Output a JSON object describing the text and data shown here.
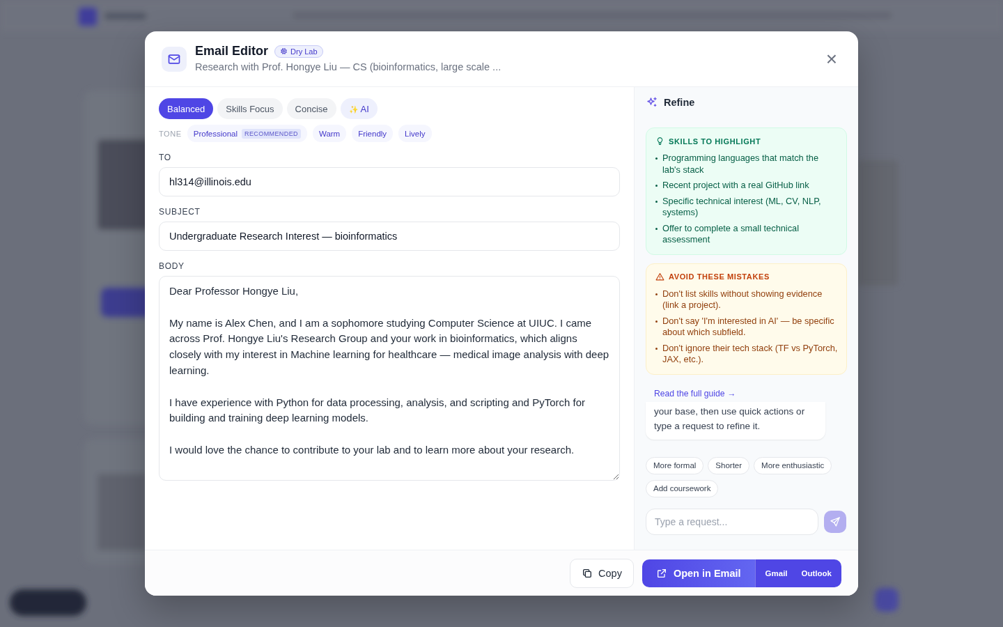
{
  "dialog": {
    "title": "Email Editor",
    "badge": "Dry Lab",
    "subtitle": "Research with Prof. Hongye Liu — CS (bioinformatics, large scale ...",
    "close_label": "×"
  },
  "styles": [
    {
      "label": "Balanced",
      "selected": true,
      "kind": "preset"
    },
    {
      "label": "Skills Focus",
      "selected": false,
      "kind": "preset"
    },
    {
      "label": "Concise",
      "selected": false,
      "kind": "preset"
    },
    {
      "label": "AI",
      "selected": false,
      "kind": "ai",
      "icon": "✨"
    }
  ],
  "tone": {
    "label": "TONE",
    "options": [
      {
        "label": "Professional",
        "tag": "RECOMMENDED"
      },
      {
        "label": "Warm"
      },
      {
        "label": "Friendly"
      },
      {
        "label": "Lively"
      }
    ]
  },
  "fields": [
    {
      "label": "TO",
      "value": "hl314@illinois.edu"
    },
    {
      "label": "SUBJECT",
      "value": "Undergraduate Research Interest — bioinformatics"
    }
  ],
  "body": {
    "label": "BODY",
    "value": "Dear Professor Hongye Liu,\n\nMy name is Alex Chen, and I am a sophomore studying Computer Science at UIUC. I came across Prof. Hongye Liu's Research Group and your work in bioinformatics, which aligns closely with my interest in Machine learning for healthcare — medical image analysis with deep learning.\n\nI have experience with Python for data processing, analysis, and scripting and PyTorch for building and training deep learning models.\n\nI would love the chance to contribute to your lab and to learn more about your research."
  },
  "refine": {
    "title": "Refine",
    "tips": [
      {
        "kind": "skills",
        "title": "SKILLS TO HIGHLIGHT",
        "items": [
          "Programming languages that match the lab's stack",
          "Recent project with a real GitHub link",
          "Specific technical interest (ML, CV, NLP, systems)",
          "Offer to complete a small technical assessment"
        ]
      },
      {
        "kind": "avoid",
        "title": "AVOID THESE MISTAKES",
        "items": [
          "Don't list skills without showing evidence (link a project).",
          "Don't say 'I'm interested in AI' — be specific about which subfield.",
          "Don't ignore their tech stack (TF vs PyTorch, JAX, etc.)."
        ]
      }
    ],
    "guide_link": "Read the full guide →",
    "message": "your base, then use quick actions or type a request to refine it.",
    "quick_actions": [
      "More formal",
      "Shorter",
      "More enthusiastic",
      "Add coursework"
    ],
    "request": {
      "placeholder": "Type a request...",
      "send_disabled": true
    }
  },
  "footer": {
    "copy": "Copy",
    "open": "Open in Email",
    "providers": [
      "Gmail",
      "Outlook"
    ]
  }
}
